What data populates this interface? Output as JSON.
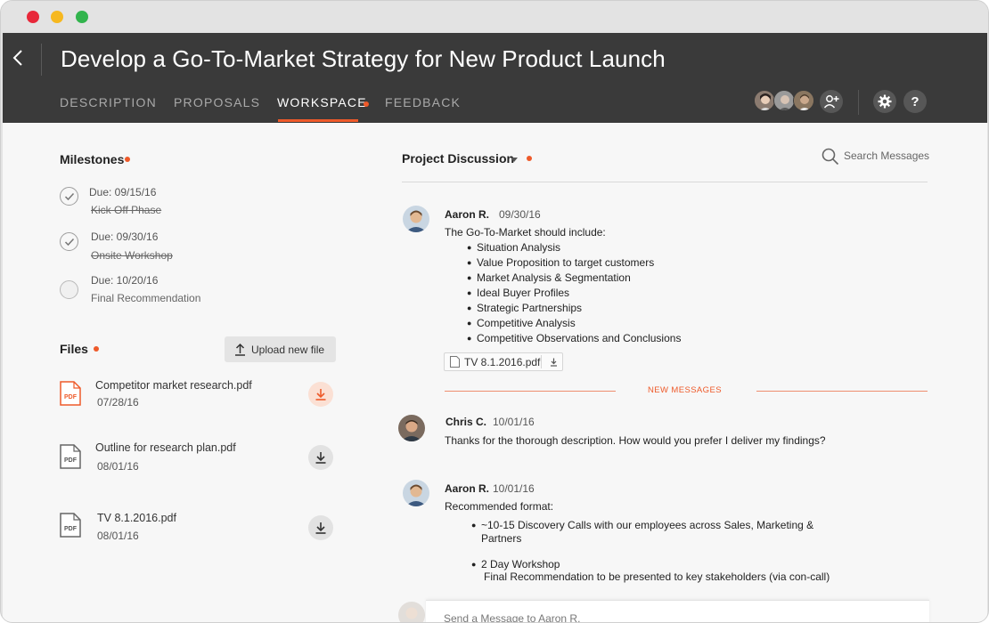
{
  "window": {
    "controls": [
      "close",
      "minimize",
      "maximize"
    ]
  },
  "header": {
    "title": "Develop a Go-To-Market Strategy for New Product Launch",
    "back_icon": "chevron-left-icon",
    "tabs": [
      {
        "label": "DESCRIPTION",
        "active": false
      },
      {
        "label": "PROPOSALS",
        "active": false
      },
      {
        "label": "WORKSPACE",
        "active": true,
        "has_notification": true
      },
      {
        "label": "FEEDBACK",
        "active": false
      }
    ],
    "actions": {
      "add_member_icon": "add-user-icon",
      "settings_icon": "gear-icon",
      "help_label": "?"
    }
  },
  "milestones": {
    "title": "Milestones",
    "items": [
      {
        "due": "Due: 09/15/16",
        "name": "Kick Off Phase",
        "done": true
      },
      {
        "due": "Due: 09/30/16",
        "name": "Onsite Workshop",
        "done": true
      },
      {
        "due": "Due: 10/20/16",
        "name": "Final Recommendation",
        "done": false
      }
    ]
  },
  "files": {
    "title": "Files",
    "upload_label": "Upload new file",
    "items": [
      {
        "name": "Competitor market research.pdf",
        "date": "07/28/16",
        "highlight": true,
        "type_label": "PDF"
      },
      {
        "name": "Outline for research plan.pdf",
        "date": "08/01/16",
        "highlight": false,
        "type_label": "PDF"
      },
      {
        "name": "TV 8.1.2016.pdf",
        "date": "08/01/16",
        "highlight": false,
        "type_label": "PDF"
      }
    ]
  },
  "discussion": {
    "title": "Project Discussion",
    "search_placeholder": "Search Messages",
    "new_messages_label": "NEW MESSAGES",
    "compose_placeholder": "Send a Message to Aaron R.",
    "messages": [
      {
        "author": "Aaron R.",
        "date": "09/30/16",
        "text": "The Go-To-Market should include:",
        "bullets": [
          "Situation Analysis",
          "Value Proposition to target customers",
          "Market Analysis & Segmentation",
          "Ideal Buyer Profiles",
          "Strategic Partnerships",
          "Competitive Analysis",
          "Competitive Observations and Conclusions"
        ],
        "attachment": "TV 8.1.2016.pdf"
      },
      {
        "author": "Chris C.",
        "date": "10/01/16",
        "text": "Thanks for the thorough description. How would you prefer I deliver my findings?"
      },
      {
        "author": "Aaron R.",
        "date": "10/01/16",
        "text": "Recommended format:",
        "bullets": [
          "~10-15 Discovery Calls with our employees across Sales, Marketing &",
          "2 Day Workshop"
        ],
        "continuations": [
          "Partners",
          "Final Recommendation to be presented to key stakeholders (via con-call)"
        ]
      }
    ]
  },
  "colors": {
    "accent": "#ee5a2a",
    "header_bg": "#3a3a3a",
    "content_bg": "#f7f7f7"
  }
}
